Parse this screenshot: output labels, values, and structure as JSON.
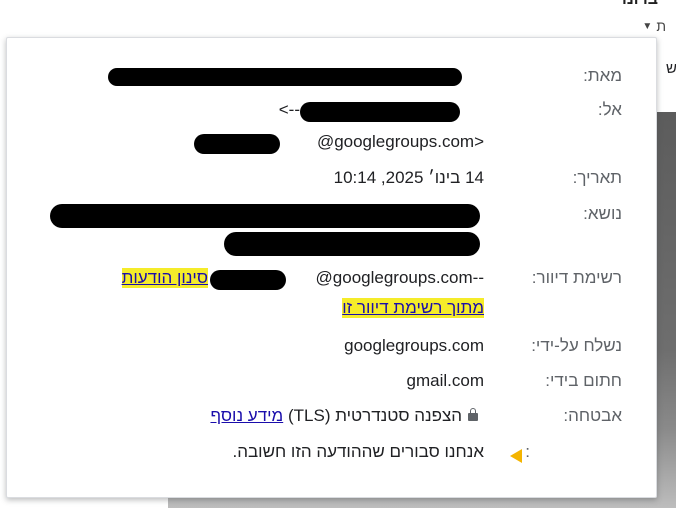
{
  "background": {
    "title": "ברונו",
    "reply_hint": "ת",
    "side_letter": "ש"
  },
  "details": {
    "from_label": "מאת:",
    "to_label": "אל:",
    "to_arrow": "<--",
    "to_domain": "@googlegroups.com>",
    "date_label": "תאריך:",
    "date_value": "14 בינו׳ 2025, 10:14",
    "subject_label": "נושא:",
    "mailing_list_label": "רשימת דיוור:",
    "mailing_list_filter_link": "סינון הודעות",
    "mailing_list_address": "@googlegroups.com--",
    "mailing_list_from_this": "מתוך רשימת דיוור זו",
    "mailed_by_label": "נשלח על-ידי:",
    "mailed_by_value": "googlegroups.com",
    "signed_by_label": "חתום בידי:",
    "signed_by_value": "gmail.com",
    "security_label": "אבטחה:",
    "security_value": "הצפנה סטנדרטית (TLS)",
    "security_link": "מידע נוסף",
    "importance_label": ":",
    "importance_value": "אנחנו סבורים שההודעה הזו חשובה."
  }
}
